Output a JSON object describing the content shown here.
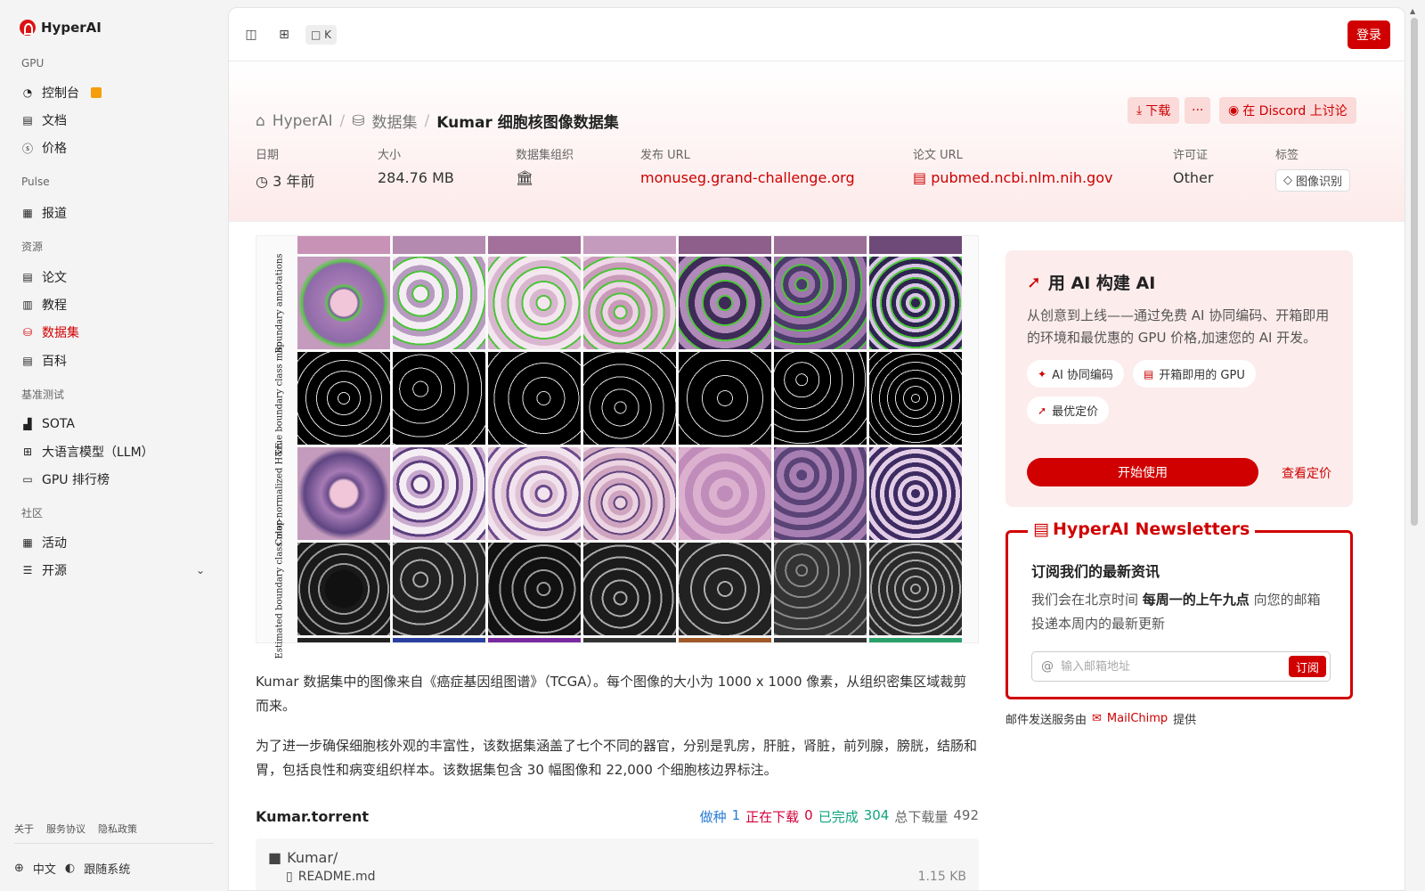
{
  "brand": "HyperAI",
  "sidebar": {
    "sections": [
      {
        "label": "GPU",
        "items": [
          {
            "label": "控制台",
            "icon": "dashboard-icon",
            "gift": true
          },
          {
            "label": "文档",
            "icon": "doc-icon"
          },
          {
            "label": "价格",
            "icon": "price-icon"
          }
        ]
      },
      {
        "label": "Pulse",
        "items": [
          {
            "label": "报道",
            "icon": "news-icon"
          }
        ]
      },
      {
        "label": "资源",
        "items": [
          {
            "label": "论文",
            "icon": "paper-icon"
          },
          {
            "label": "教程",
            "icon": "tutorial-icon"
          },
          {
            "label": "数据集",
            "icon": "database-icon",
            "active": true
          },
          {
            "label": "百科",
            "icon": "wiki-icon"
          }
        ]
      },
      {
        "label": "基准测试",
        "items": [
          {
            "label": "SOTA",
            "icon": "chart-icon"
          },
          {
            "label": "大语言模型（LLM）",
            "icon": "chip-icon"
          },
          {
            "label": "GPU 排行榜",
            "icon": "monitor-icon"
          }
        ]
      },
      {
        "label": "社区",
        "items": [
          {
            "label": "活动",
            "icon": "calendar-icon"
          },
          {
            "label": "开源",
            "icon": "list-icon",
            "expandable": true
          }
        ]
      }
    ],
    "footer_links": [
      "关于",
      "服务协议",
      "隐私政策"
    ],
    "language": "中文",
    "theme": "跟随系统"
  },
  "topbar": {
    "shortcut": "K",
    "login": "登录"
  },
  "breadcrumb": {
    "home": "HyperAI",
    "section": "数据集",
    "current": "Kumar 细胞核图像数据集"
  },
  "actions": {
    "download": "下载",
    "more": "···",
    "discord": "在 Discord 上讨论"
  },
  "meta": {
    "date": {
      "label": "日期",
      "value": "3 年前"
    },
    "size": {
      "label": "大小",
      "value": "284.76 MB"
    },
    "org": {
      "label": "数据集组织"
    },
    "publish": {
      "label": "发布 URL",
      "value": "monuseg.grand-challenge.org"
    },
    "paper": {
      "label": "论文 URL",
      "value": "pubmed.ncbi.nlm.nih.gov"
    },
    "license": {
      "label": "许可证",
      "value": "Other"
    },
    "tags": {
      "label": "标签",
      "value": "图像识别"
    }
  },
  "figure": {
    "row_labels": [
      "Boundary annotations",
      "True boundary class map",
      "Color-normalized H&E",
      "Estimated boundary class map"
    ]
  },
  "description": [
    "Kumar 数据集中的图像来自《癌症基因组图谱》（TCGA）。每个图像的大小为 1000 x 1000 像素，从组织密集区域裁剪而来。",
    "为了进一步确保细胞核外观的丰富性，该数据集涵盖了七个不同的器官，分别是乳房，肝脏，肾脏，前列腺，膀胱，结肠和胃，包括良性和病变组织样本。该数据集包含 30 幅图像和 22,000 个细胞核边界标注。"
  ],
  "torrent": {
    "title": "Kumar.torrent",
    "seed_label": "做种",
    "seed": "1",
    "downloading_label": "正在下载",
    "downloading": "0",
    "completed_label": "已完成",
    "completed": "304",
    "total_label": "总下载量",
    "total": "492",
    "folder": "Kumar/",
    "file": "README.md",
    "file_size": "1.15 KB"
  },
  "promo": {
    "title": "用 AI 构建 AI",
    "desc": "从创意到上线——通过免费 AI 协同编码、开箱即用的环境和最优惠的 GPU 价格,加速您的 AI 开发。",
    "chips": [
      "AI 协同编码",
      "开箱即用的 GPU",
      "最优定价"
    ],
    "start": "开始使用",
    "pricing": "查看定价"
  },
  "newsletter": {
    "title": "HyperAI Newsletters",
    "heading": "订阅我们的最新资讯",
    "desc_pre": "我们会在北京时间 ",
    "desc_bold": "每周一的上午九点",
    "desc_post": " 向您的邮箱投递本周内的最新更新",
    "placeholder": "输入邮箱地址",
    "subscribe": "订阅",
    "by_pre": "邮件发送服务由",
    "by_provider": "MailChimp",
    "by_post": "提供"
  },
  "colors": {
    "accent": "#d10000",
    "seed": "#2b7bd8",
    "downloading": "#d1003a",
    "completed": "#10a37f",
    "total": "#666666"
  }
}
